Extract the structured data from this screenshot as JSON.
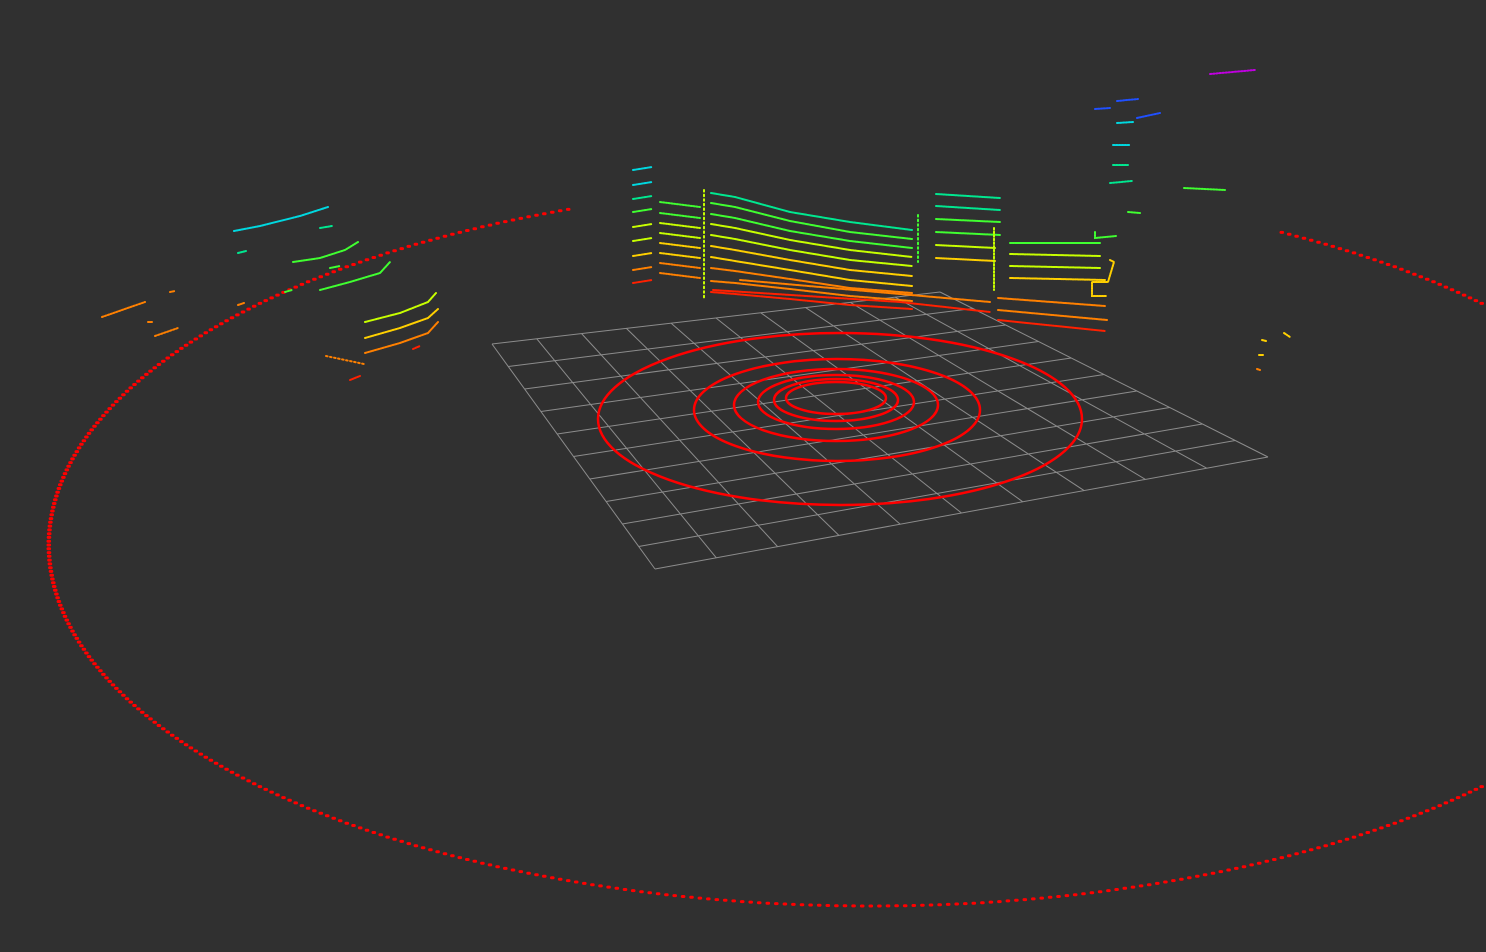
{
  "view": {
    "background": "#303030"
  },
  "grid": {
    "color": "#8c8c8c",
    "cells_u": 10,
    "cells_v": 10
  },
  "rings": {
    "color": "#ff0000",
    "count": 6
  },
  "outer_ring": {
    "color": "#ff0000"
  },
  "point_cloud": {
    "colormap": [
      "#ff2000",
      "#ff8000",
      "#ffd000",
      "#c8ff00",
      "#40ff30",
      "#00e890",
      "#00d8e0",
      "#2050ff",
      "#c000e0"
    ]
  }
}
